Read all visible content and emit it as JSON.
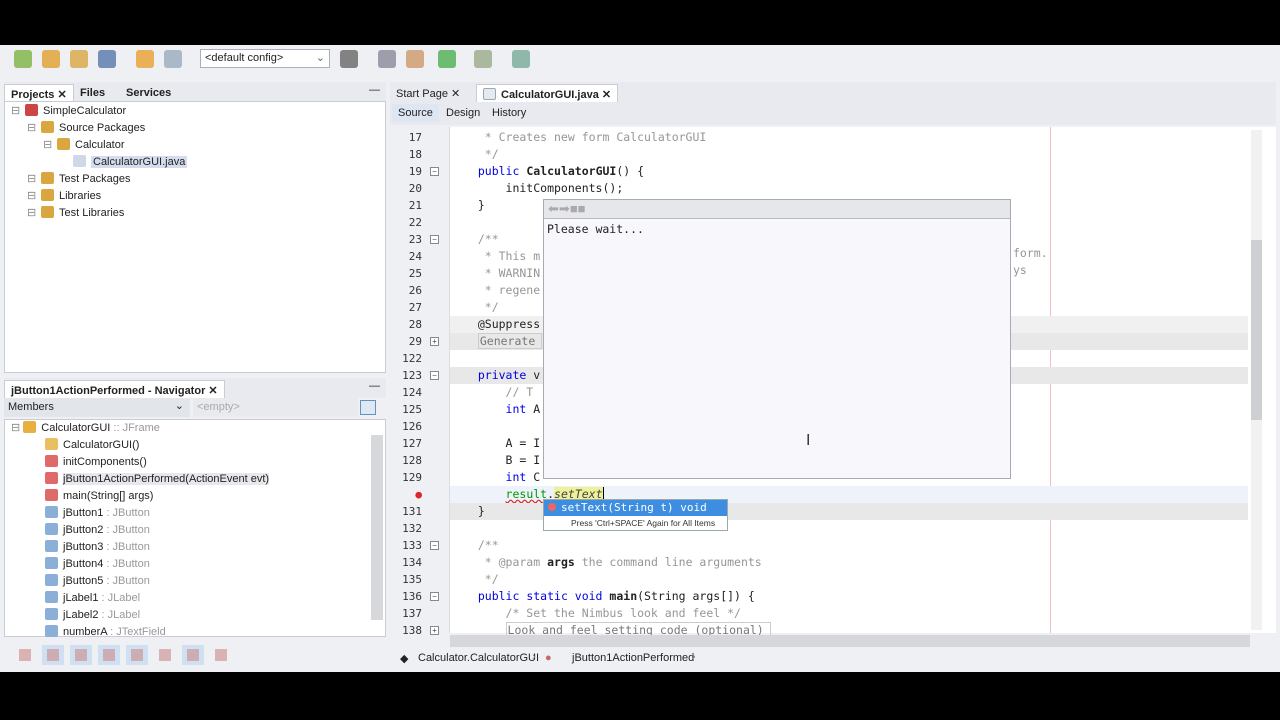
{
  "toolbar": {
    "config_select": "<default config>",
    "icons": [
      "new-file-icon",
      "new-project-icon",
      "open-project-icon",
      "save-all-icon",
      "undo-icon",
      "redo-icon",
      "browser-icon",
      "build-icon",
      "clean-build-icon",
      "run-icon",
      "debug-icon",
      "profile-icon"
    ]
  },
  "projects_panel": {
    "tabs": [
      "Projects",
      "Files",
      "Services"
    ],
    "tree": [
      {
        "label": "SimpleCalculator",
        "level": 0
      },
      {
        "label": "Source Packages",
        "level": 1
      },
      {
        "label": "Calculator",
        "level": 2
      },
      {
        "label": "CalculatorGUI.java",
        "level": 3,
        "selected": true
      },
      {
        "label": "Test Packages",
        "level": 1
      },
      {
        "label": "Libraries",
        "level": 1
      },
      {
        "label": "Test Libraries",
        "level": 1
      }
    ]
  },
  "navigator": {
    "title": "jButton1ActionPerformed - Navigator",
    "filter": "Members",
    "empty_select": "<empty>",
    "root": {
      "name": "CalculatorGUI",
      "type": " :: JFrame"
    },
    "members": [
      {
        "name": "CalculatorGUI()",
        "type": ""
      },
      {
        "name": "initComponents()",
        "type": ""
      },
      {
        "name": "jButton1ActionPerformed(ActionEvent evt)",
        "type": "",
        "selected": true
      },
      {
        "name": "main(String[] args)",
        "type": ""
      },
      {
        "name": "jButton1",
        "type": " : JButton"
      },
      {
        "name": "jButton2",
        "type": " : JButton"
      },
      {
        "name": "jButton3",
        "type": " : JButton"
      },
      {
        "name": "jButton4",
        "type": " : JButton"
      },
      {
        "name": "jButton5",
        "type": " : JButton"
      },
      {
        "name": "jLabel1",
        "type": " : JLabel"
      },
      {
        "name": "jLabel2",
        "type": " : JLabel"
      },
      {
        "name": "numberA",
        "type": " : JTextField"
      }
    ]
  },
  "editor": {
    "tabs": [
      {
        "label": "Start Page"
      },
      {
        "label": "CalculatorGUI.java",
        "active": true
      }
    ],
    "view_tabs": [
      "Source",
      "Design",
      "History"
    ],
    "lines": [
      {
        "n": "17",
        "text": "   * Creates new form CalculatorGUI",
        "cls": "cm"
      },
      {
        "n": "18",
        "text": "   */",
        "cls": "cm"
      },
      {
        "n": "19",
        "text": "  public CalculatorGUI() {",
        "cls": "pub"
      },
      {
        "n": "20",
        "text": "      initComponents();",
        "cls": ""
      },
      {
        "n": "21",
        "text": "  }",
        "cls": ""
      },
      {
        "n": "22",
        "text": "",
        "cls": ""
      },
      {
        "n": "23",
        "text": "  /**",
        "cls": "cm"
      },
      {
        "n": "24",
        "text": "   * This m",
        "cls": "cm"
      },
      {
        "n": "25",
        "text": "   * WARNIN",
        "cls": "cm"
      },
      {
        "n": "26",
        "text": "   * regene",
        "cls": "cm"
      },
      {
        "n": "27",
        "text": "   */",
        "cls": "cm"
      },
      {
        "n": "28",
        "text": "  @Suppress",
        "cls": ""
      },
      {
        "n": "29",
        "text": "  Generate",
        "cls": "fold"
      },
      {
        "n": "122",
        "text": "",
        "cls": ""
      },
      {
        "n": "123",
        "text": "  private v",
        "cls": "kw"
      },
      {
        "n": "124",
        "text": "      // T",
        "cls": "cm"
      },
      {
        "n": "125",
        "text": "      int A",
        "cls": "int"
      },
      {
        "n": "126",
        "text": "",
        "cls": ""
      },
      {
        "n": "127",
        "text": "      A = I",
        "cls": ""
      },
      {
        "n": "128",
        "text": "      B = I",
        "cls": ""
      },
      {
        "n": "129",
        "text": "      int C",
        "cls": "int"
      },
      {
        "n": "130",
        "text": "      result.setText",
        "cls": "err"
      },
      {
        "n": "131",
        "text": "  }",
        "cls": ""
      },
      {
        "n": "132",
        "text": "",
        "cls": ""
      },
      {
        "n": "133",
        "text": "  /**",
        "cls": "cm"
      },
      {
        "n": "134",
        "text": "   * @param args the command line arguments",
        "cls": "param"
      },
      {
        "n": "135",
        "text": "   */",
        "cls": "cm"
      },
      {
        "n": "136",
        "text": "  public static void main(String args[]) {",
        "cls": "main"
      },
      {
        "n": "137",
        "text": "      /* Set the Nimbus look and feel */",
        "cls": "cm"
      },
      {
        "n": "138",
        "text": "      Look and feel setting code (optional)",
        "cls": "fold"
      }
    ],
    "right_fragments": {
      "line24": "form.",
      "line25": "ys"
    },
    "javadoc_popup": {
      "text": "Please wait..."
    },
    "completion": {
      "item": "setText(String t) void",
      "hint": "Press 'Ctrl+SPACE' Again for All Items"
    },
    "breadcrumb": [
      "Calculator.CalculatorGUI",
      "jButton1ActionPerformed"
    ]
  },
  "colors": {
    "selection": "#3d8ee0",
    "error": "#d9262c",
    "keyword": "#0000e6",
    "comment": "#969696"
  }
}
